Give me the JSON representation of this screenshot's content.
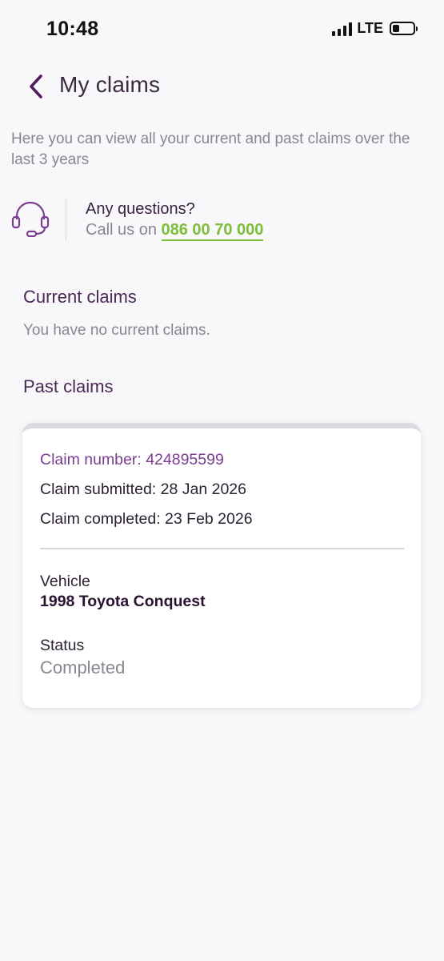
{
  "status_bar": {
    "time": "10:48",
    "network": "LTE",
    "battery_level": 0.35,
    "signal_bars": 4
  },
  "header": {
    "title": "My claims",
    "back_icon": "chevron-left-icon"
  },
  "intro": "Here you can view all your current and past claims over the last 3 years",
  "contact": {
    "icon": "headset-icon",
    "question": "Any questions?",
    "call_prefix": "Call us on",
    "phone": "086 00 70 000"
  },
  "current_claims": {
    "title": "Current claims",
    "empty_message": "You have no current claims."
  },
  "past_claims": {
    "title": "Past claims",
    "claims": [
      {
        "claim_number": "Claim number: 424895599",
        "submitted": "Claim submitted: 28 Jan 2026",
        "completed": "Claim completed: 23 Feb 2026",
        "vehicle_label": "Vehicle",
        "vehicle": "1998 Toyota Conquest",
        "status_label": "Status",
        "status": "Completed"
      }
    ]
  },
  "colors": {
    "accent_purple": "#5b2a6e",
    "claim_number_purple": "#7b3d90",
    "link_green": "#7cbd3a",
    "muted_text": "#8b8590",
    "background": "#f8f7fa"
  }
}
